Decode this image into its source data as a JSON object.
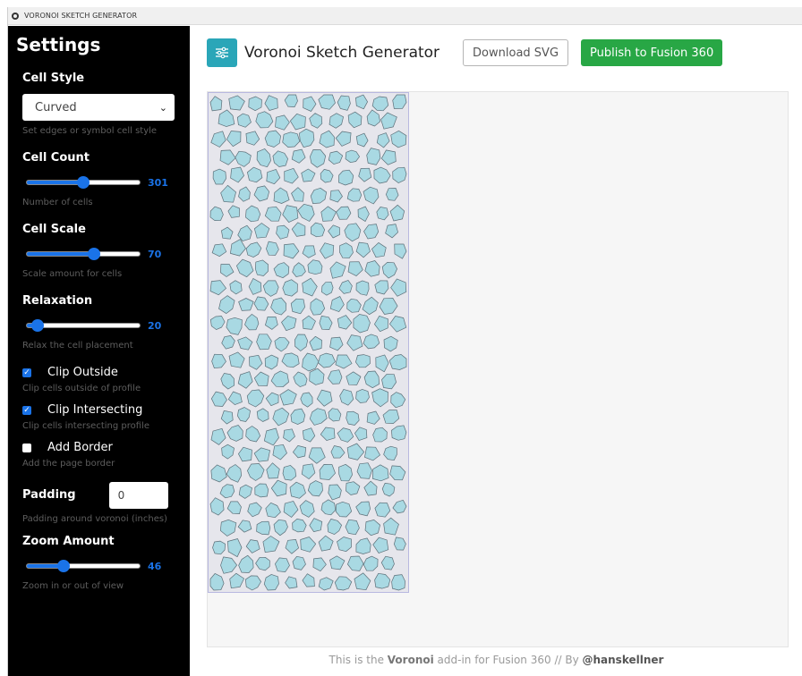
{
  "window": {
    "title": "VORONOI SKETCH GENERATOR"
  },
  "sidebar": {
    "heading": "Settings",
    "cell_style": {
      "label": "Cell Style",
      "value": "Curved",
      "help": "Set edges or symbol cell style"
    },
    "cell_count": {
      "label": "Cell Count",
      "value": 301,
      "display": "301",
      "min": 0,
      "max": 600,
      "help": "Number of cells"
    },
    "cell_scale": {
      "label": "Cell Scale",
      "value": 70,
      "display": "70",
      "min": 0,
      "max": 115,
      "help": "Scale amount for cells"
    },
    "relaxation": {
      "label": "Relaxation",
      "value": 20,
      "display": "20",
      "min": 0,
      "max": 400,
      "help": "Relax the cell placement"
    },
    "clip_outside": {
      "label": "Clip Outside",
      "checked": true,
      "help": "Clip cells outside of profile"
    },
    "clip_intersecting": {
      "label": "Clip Intersecting",
      "checked": true,
      "help": "Clip cells intersecting profile"
    },
    "add_border": {
      "label": "Add Border",
      "checked": false,
      "help": "Add the page border"
    },
    "padding": {
      "label": "Padding",
      "value": "0",
      "help": "Padding around voronoi (inches)"
    },
    "zoom": {
      "label": "Zoom Amount",
      "value": 46,
      "display": "46",
      "min": 0,
      "max": 150,
      "help": "Zoom in or out of view"
    }
  },
  "header": {
    "title": "Voronoi Sketch Generator",
    "download_label": "Download SVG",
    "publish_label": "Publish to Fusion 360"
  },
  "footer": {
    "prefix": "This is the ",
    "bold_word": "Voronoi",
    "middle": " add-in for Fusion 360 // By ",
    "handle": "@hanskellner"
  },
  "colors": {
    "accent": "#1a73e8",
    "publish_green": "#28a745",
    "logo_teal": "#2aa6b8",
    "cell_fill": "#a9d9e3",
    "cell_stroke": "#5c6f78"
  }
}
